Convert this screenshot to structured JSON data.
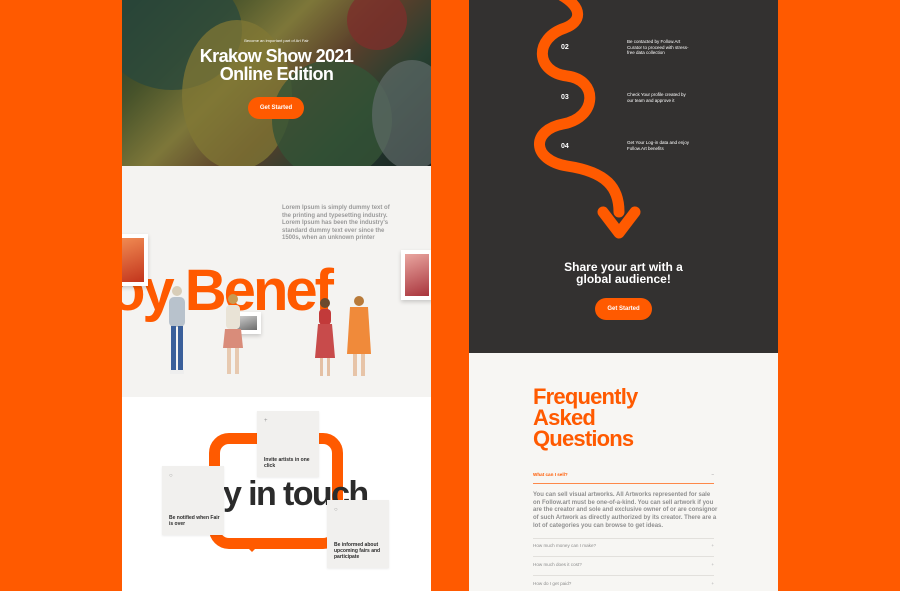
{
  "hero": {
    "kicker": "Become an important part of Art Fair",
    "title_line1": "Krakow Show 2021",
    "title_line2": "Online Edition",
    "cta_label": "Get Started"
  },
  "gallery": {
    "description": "Lorem Ipsum is simply dummy text of the printing and typesetting industry. Lorem Ipsum has been the industry's standard dummy text ever since the 1500s, when an unknown printer",
    "big_word": "oy Benef"
  },
  "touch": {
    "big_word": "y in touch",
    "cards": [
      {
        "icon": "○",
        "text_line1": "Be notified when Fair",
        "text_line2": "is over"
      },
      {
        "icon": "+",
        "text_line1": "Invite artists in one",
        "text_line2": "click"
      },
      {
        "icon": "○",
        "text_line1": "Be informed about",
        "text_line2": "upcoming fairs and participate"
      }
    ]
  },
  "steps": [
    {
      "number": "02",
      "text": "Be contacted by Follow.Art Curator to proceed with stress-free data collection"
    },
    {
      "number": "03",
      "text": "Check Your profile created by our team and approve it"
    },
    {
      "number": "04",
      "text": "Get Your Log-in data and enjoy Follow.Art benefits"
    }
  ],
  "share": {
    "title_line1": "Share your art with a",
    "title_line2": "global audience!",
    "cta_label": "Get Started"
  },
  "faq": {
    "title_line1": "Frequently",
    "title_line2": "Asked",
    "title_line3": "Questions",
    "active_question": "What can I sell?",
    "answer": "You can sell visual artworks. All Artworks represented for sale on Follow.art must be one-of-a-kind. You can sell artwork if you are the creator and sole and exclusive owner of or are consignor of such Artwork as directly authorized by its creator. There are a lot of categories you can browse to get ideas.",
    "questions": [
      "How much money can I make?",
      "How much does it cost?",
      "How do I get paid?"
    ],
    "open_symbol": "−",
    "closed_symbol": "+"
  },
  "colors": {
    "accent": "#FF5A00",
    "dark": "#333130",
    "light": "#f7f6f3"
  }
}
